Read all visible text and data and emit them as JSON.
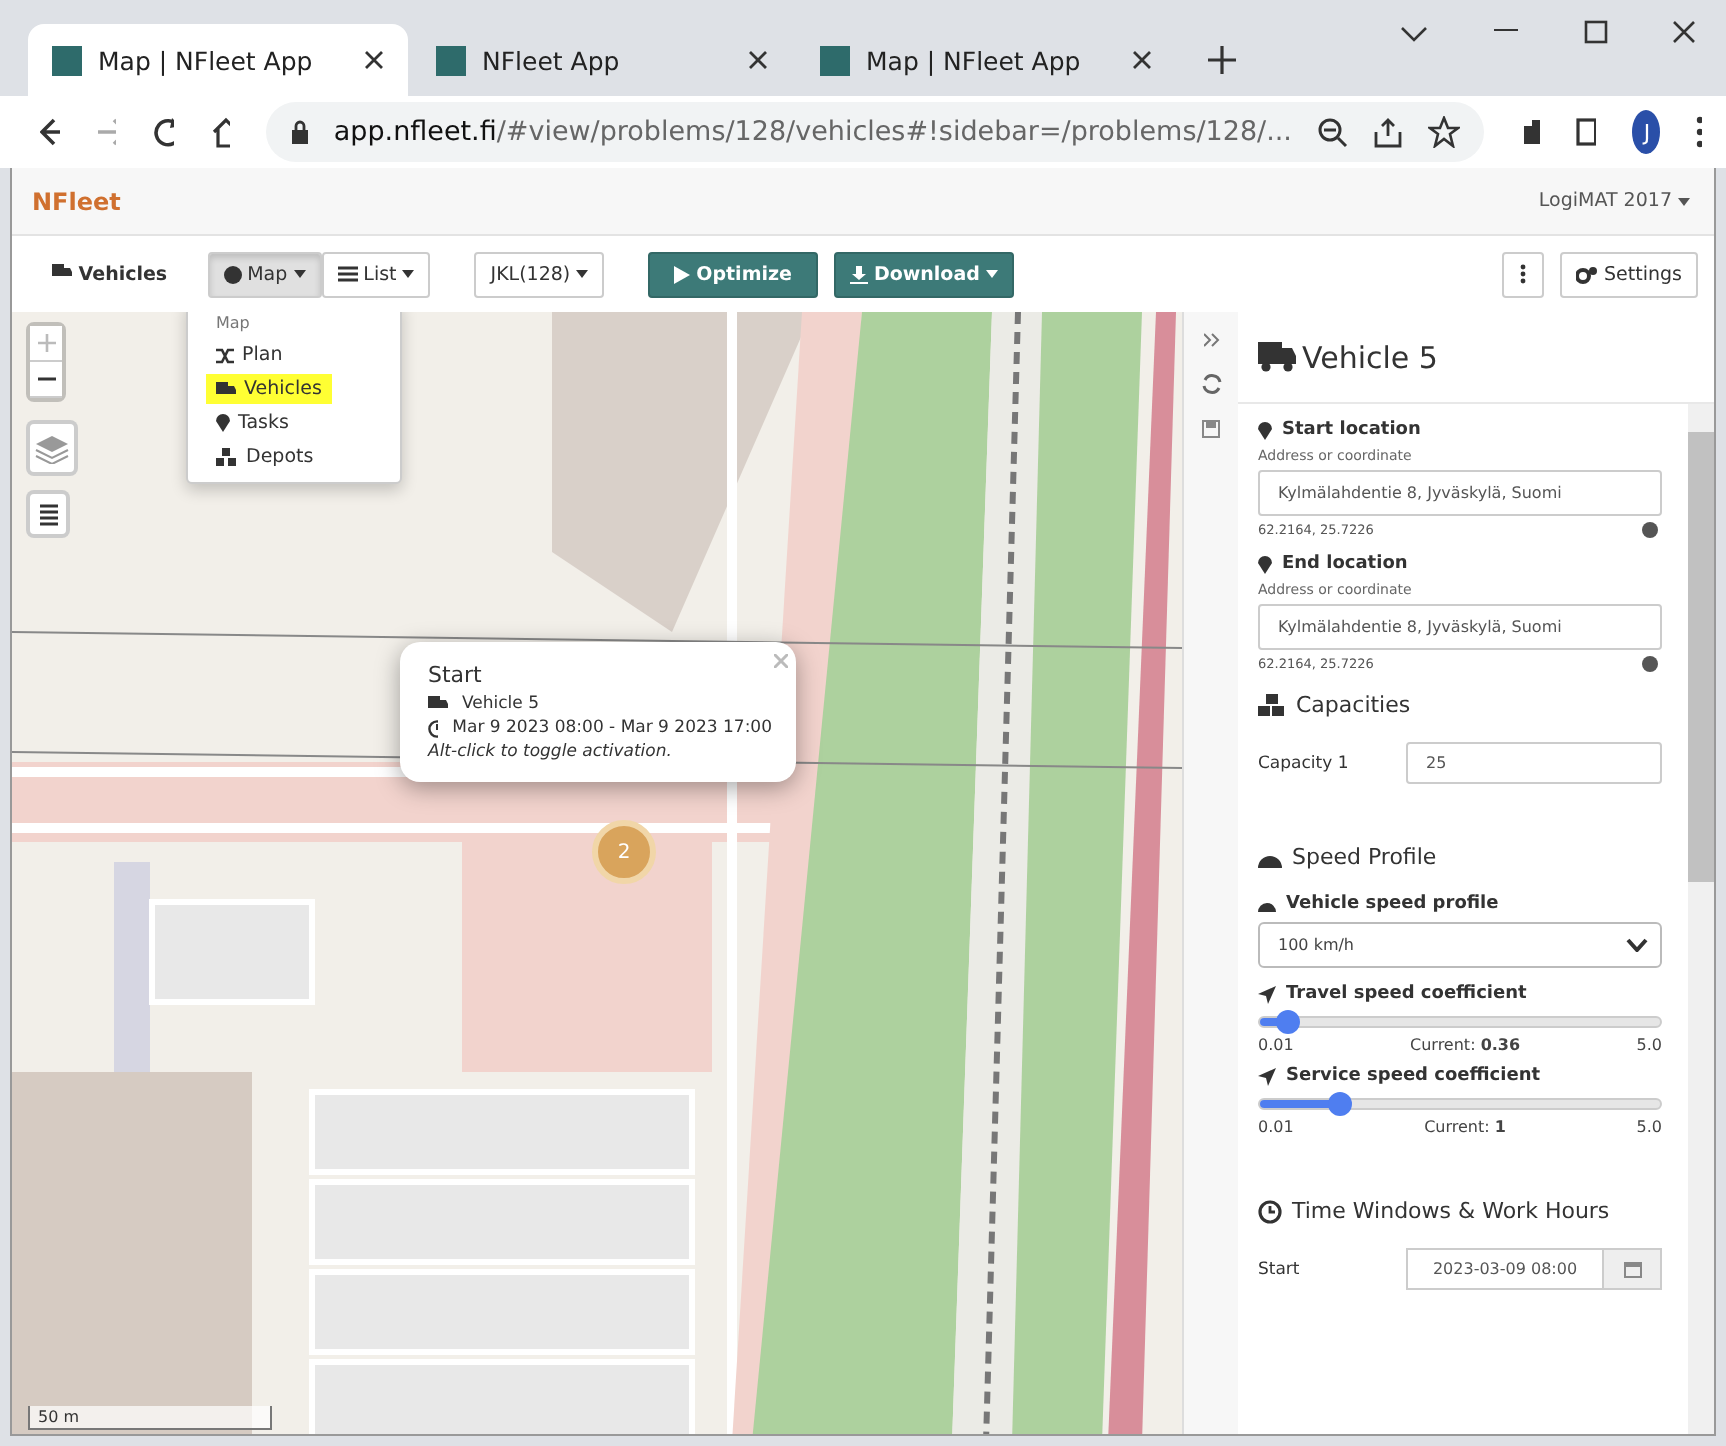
{
  "browser": {
    "tabs": [
      {
        "title": "Map | NFleet App",
        "selected": true
      },
      {
        "title": "NFleet App",
        "selected": false
      },
      {
        "title": "Map | NFleet App",
        "selected": false
      }
    ],
    "address": {
      "domain": "app.nfleet.fi",
      "path": "/#view/problems/128/vehicles#!sidebar=/problems/128/..."
    },
    "profile": "J"
  },
  "app": {
    "brand": "NFleet",
    "account": "LogiMAT 2017"
  },
  "toolbar": {
    "vehicles_link": "Vehicles",
    "views": [
      {
        "label": "Map",
        "selected": true
      },
      {
        "label": "List",
        "selected": false
      }
    ],
    "problem": "JKL(128)",
    "optimize": "Optimize",
    "download": "Download",
    "settings": "Settings"
  },
  "dropdown": {
    "header": "Map",
    "items": [
      {
        "label": "Plan",
        "kind": "plan",
        "selected": false
      },
      {
        "label": "Vehicles",
        "kind": "vehicles",
        "selected": true
      },
      {
        "label": "Tasks",
        "kind": "tasks",
        "selected": false
      },
      {
        "label": "Depots",
        "kind": "depots",
        "selected": false
      }
    ]
  },
  "map": {
    "scale": "50 m",
    "cluster": "2",
    "popup": {
      "title": "Start",
      "vehicle": "Vehicle 5",
      "time": "Mar 9 2023 08:00 - Mar 9 2023 17:00",
      "hint": "Alt-click to toggle activation."
    }
  },
  "sidebar": {
    "title": "Vehicle 5",
    "locations": [
      {
        "label": "Start location",
        "hint": "Address or coordinate",
        "value": "Kylmälahdentie 8, Jyväskylä, Suomi",
        "coords": "62.2164, 25.7226"
      },
      {
        "label": "End location",
        "hint": "Address or coordinate",
        "value": "Kylmälahdentie 8, Jyväskylä, Suomi",
        "coords": "62.2164, 25.7226"
      }
    ],
    "capacities": {
      "heading": "Capacities",
      "items": [
        {
          "label": "Capacity 1",
          "value": "25"
        }
      ]
    },
    "speed": {
      "heading": "Speed Profile",
      "select_label": "Vehicle speed profile",
      "select_value": "100 km/h",
      "sliders": [
        {
          "label": "Travel speed coefficient",
          "min": "0.01",
          "max": "5.0",
          "current": "Current: **0.36**",
          "level": 0.07
        },
        {
          "label": "Service speed coefficient",
          "min": "0.01",
          "max": "5.0",
          "current": "Current: **1**",
          "level": 0.2
        }
      ]
    },
    "time": {
      "heading": "Time Windows & Work Hours",
      "start_label": "Start",
      "start_value": "2023-03-09 08:00"
    }
  }
}
